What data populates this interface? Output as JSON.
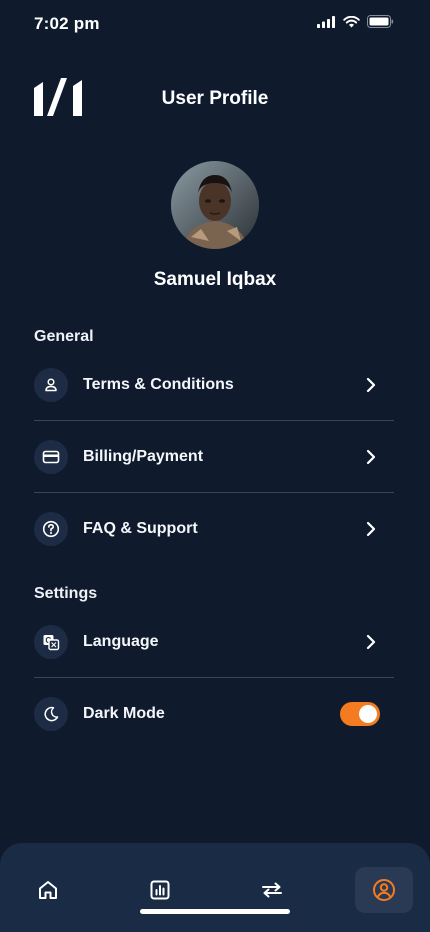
{
  "status_bar": {
    "time": "7:02 pm",
    "icons": [
      "signal-icon",
      "wifi-icon",
      "battery-icon"
    ]
  },
  "header": {
    "title": "User Profile",
    "logo_icon": "brand-logo"
  },
  "profile": {
    "name": "Samuel Iqbax"
  },
  "general": {
    "title": "General",
    "items": [
      {
        "label": "Terms & Conditions",
        "icon": "user-icon"
      },
      {
        "label": "Billing/Payment",
        "icon": "credit-card-icon"
      },
      {
        "label": "FAQ & Support",
        "icon": "help-circle-icon"
      }
    ]
  },
  "settings": {
    "title": "Settings",
    "items": [
      {
        "label": "Language",
        "icon": "translate-icon"
      },
      {
        "label": "Dark Mode",
        "icon": "moon-icon",
        "toggle_on": true
      }
    ]
  },
  "tab_bar": {
    "tabs": [
      {
        "icon": "home-icon",
        "active": false
      },
      {
        "icon": "chart-icon",
        "active": false
      },
      {
        "icon": "transfer-icon",
        "active": false
      },
      {
        "icon": "profile-icon",
        "active": true
      }
    ]
  },
  "colors": {
    "background": "#0f1b2d",
    "accent": "#f47b20",
    "tab_bar": "#1a2b45"
  }
}
